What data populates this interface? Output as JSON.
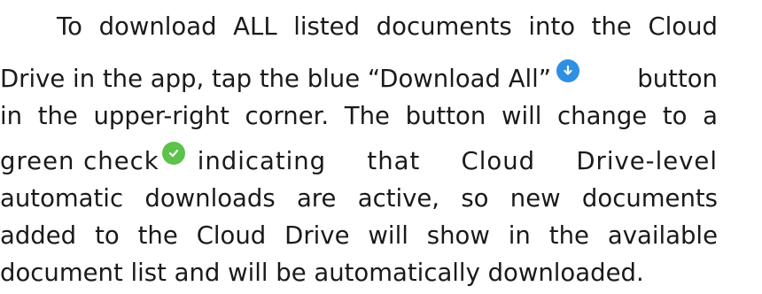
{
  "paragraph": {
    "line1": "To download ALL listed documents into the Cloud",
    "line2_a": "Drive in the app, tap the blue “Download All”",
    "line2_b": "button",
    "line3": "in the upper-right corner. The button will change to a",
    "line4_a": "green check",
    "line4_b": "indicating that Cloud Drive-level",
    "line5": "automatic downloads are active, so new documents",
    "line6": "added to the Cloud Drive will show in the available",
    "line7": "document list and will be automatically downloaded."
  },
  "icons": {
    "download": {
      "name": "download-arrow-icon",
      "color": "#2f8fe3"
    },
    "check": {
      "name": "check-icon",
      "color": "#5cc24a"
    }
  }
}
